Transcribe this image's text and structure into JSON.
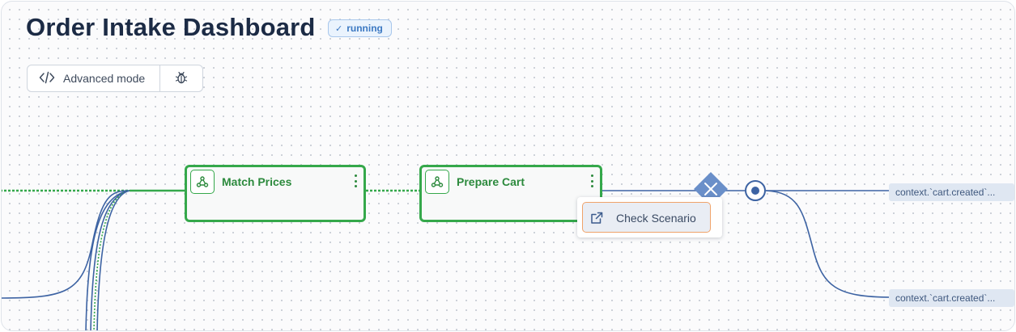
{
  "header": {
    "title": "Order Intake Dashboard",
    "status_badge": "running"
  },
  "toolbar": {
    "advanced_mode_label": "Advanced mode",
    "advanced_mode_icon": "code-brackets-icon",
    "debug_icon": "bug-icon"
  },
  "flow": {
    "nodes": [
      {
        "label": "Match Prices",
        "icon": "webhook-icon",
        "state": "success"
      },
      {
        "label": "Prepare Cart",
        "icon": "webhook-icon",
        "state": "success"
      }
    ],
    "node_menu": {
      "items": [
        {
          "label": "Check Scenario",
          "icon": "external-link-icon"
        }
      ]
    },
    "outputs": [
      {
        "label": "context.`cart.created`..."
      },
      {
        "label": "context.`cart.created`..."
      }
    ]
  },
  "colors": {
    "title": "#1c2b45",
    "success_green": "#35a84b",
    "edge_blue": "#3d63a3",
    "badge_blue": "#3b78c2",
    "menu_highlight_border": "#f0a36a",
    "output_tag_bg": "#dfe7f2"
  }
}
